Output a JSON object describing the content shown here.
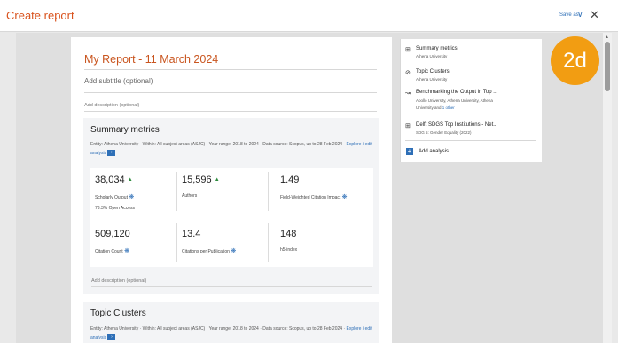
{
  "header": {
    "title": "Create report",
    "save_as": "Save as",
    "save_chevron": "∨",
    "close": "✕"
  },
  "report": {
    "title": "My Report - 11 March 2024",
    "subtitle_placeholder": "Add subtitle (optional)",
    "description_placeholder": "Add description (optional)",
    "summary": {
      "title": "Summary metrics",
      "meta": "Entity: Athena University · Within: All subject areas (ASJC) · Year range: 2018 to 2024 · Data source: Scopus, up to 28 Feb 2024 ·",
      "link": "Explore / edit analysis",
      "metrics": [
        {
          "value": "38,034",
          "label": "Scholarly Output",
          "extra": "73.3% Open Access"
        },
        {
          "value": "15,596",
          "label": "Authors"
        },
        {
          "value": "1.49",
          "label": "Field-Weighted Citation Impact"
        },
        {
          "value": "509,120",
          "label": "Citation Count"
        },
        {
          "value": "13.4",
          "label": "Citations per Publication"
        },
        {
          "value": "148",
          "label": "h5-index"
        }
      ],
      "desc_placeholder": "Add description (optional)"
    },
    "topic": {
      "title": "Topic Clusters",
      "meta": "Entity: Athena University · Within: All subject areas (ASJC) · Year range: 2018 to 2024 · Data source: Scopus, up to 28 Feb 2024 ·",
      "link": "Explore / edit analysis"
    }
  },
  "sidebar": {
    "items": [
      {
        "icon": "table-icon",
        "title": "Summary metrics",
        "sub": "Athena University"
      },
      {
        "icon": "clusters-icon",
        "title": "Topic Clusters",
        "sub": "Athena University"
      },
      {
        "icon": "trend-icon",
        "title": "Benchmarking the Output in Top ...",
        "sub": "Apollo University, Athena University, Athena",
        "sub2a": "University and",
        "sub2b": "1 other"
      },
      {
        "icon": "table-icon",
        "title": "Delft SDGS Top Institutions - Net...",
        "sub": "SDG 5: Gender Equality (2022)"
      }
    ],
    "add_label": "Add analysis"
  },
  "badge": {
    "text": "2d",
    "color": "#f29d12"
  },
  "colors": {
    "accent": "#2e6fb7",
    "title": "#d9531e",
    "up_arrow": "#2e8b3e"
  }
}
